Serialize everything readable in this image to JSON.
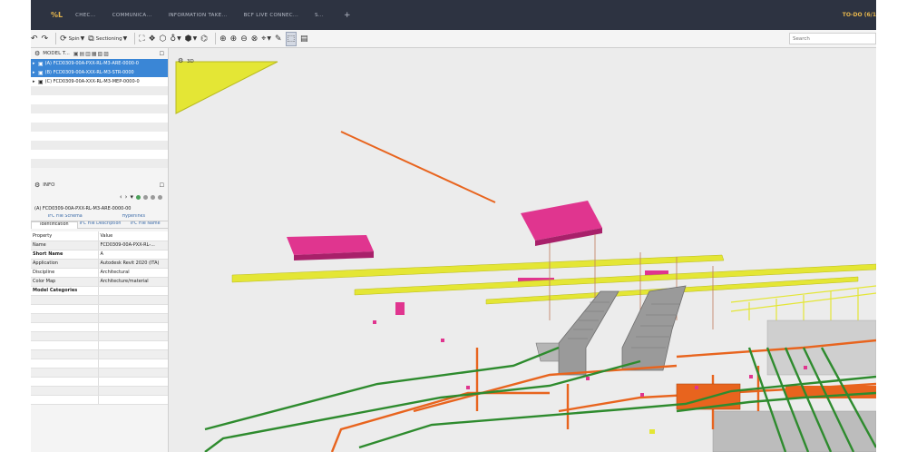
{
  "topbar": {
    "logo": "%L",
    "tabs": [
      "CHEC...",
      "COMMUNICA...",
      "INFORMATION TAKE...",
      "BCF LIVE CONNEC...",
      "S..."
    ],
    "add": "+",
    "todo": "TO-DO (6/1"
  },
  "toolbar": {
    "spin_label": "Spin",
    "sectioning_label": "Sectioning",
    "search_placeholder": "Search"
  },
  "modeltree": {
    "title": "MODEL T...",
    "items": [
      {
        "toggle": "▸",
        "label": "(A) FCD0309-00A-PXX-RL-M3-ARE-0000-0"
      },
      {
        "toggle": "▸",
        "label": "(B) FCD0309-00A-XXX-RL-M3-STR-0000"
      },
      {
        "toggle": "▸",
        "label": "(C) FCD0309-00A-XXX-RL-M3-MEP-0000-0"
      }
    ]
  },
  "info": {
    "title": "INFO",
    "selected": "(A) FCD0309-00A-PXX-RL-M3-ARE-0000-00",
    "tabs_row1": [
      "IFC File Schema",
      "Hyperlinks"
    ],
    "tabs_row2": [
      "Identification",
      "IFC File Description",
      "IFC File Name"
    ],
    "col_property": "Property",
    "col_value": "Value",
    "rows": [
      {
        "k": "Name",
        "v": "FCD0309-00A-PXX-RL-..."
      },
      {
        "k": "Short Name",
        "v": "A"
      },
      {
        "k": "Application",
        "v": "Autodesk Revit 2020 (ITA)"
      },
      {
        "k": "Discipline",
        "v": "Architectural"
      },
      {
        "k": "Color Map",
        "v": "Architecture/material"
      },
      {
        "k": "Model Categories",
        "v": ""
      }
    ]
  },
  "viewport": {
    "label": "3D"
  },
  "colors": {
    "topbar": "#2d3341",
    "accent": "#e6b64d",
    "selection": "#3a86d6",
    "magenta": "#e0358f",
    "yellow": "#e4e635",
    "orange": "#e8641e",
    "green": "#2e8b2e",
    "escalator": "#9a9a9a"
  }
}
